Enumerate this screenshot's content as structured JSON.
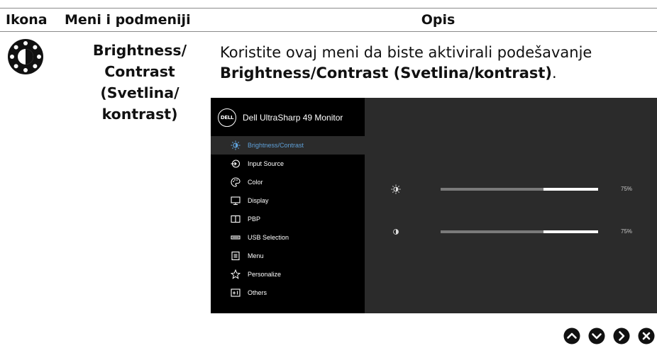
{
  "table": {
    "headers": [
      "Ikona",
      "Meni i podmeniji",
      "Opis"
    ]
  },
  "row": {
    "menu_name_lines": [
      "Brightness/",
      "Contrast",
      "(Svetlina/",
      "kontrast)"
    ],
    "desc_line1": "Koristite ovaj meni da biste aktivirali podešavanje",
    "desc_bold": "Brightness/Contrast (Svetlina/kontrast)",
    "desc_end": "."
  },
  "osd": {
    "logo_text": "DELL",
    "title": "Dell UltraSharp 49 Monitor",
    "menu_items": [
      {
        "label": "Brightness/Contrast",
        "icon": "brightness-icon",
        "active": true
      },
      {
        "label": "Input Source",
        "icon": "input-source-icon",
        "active": false
      },
      {
        "label": "Color",
        "icon": "color-icon",
        "active": false
      },
      {
        "label": "Display",
        "icon": "display-icon",
        "active": false
      },
      {
        "label": "PBP",
        "icon": "pbp-icon",
        "active": false
      },
      {
        "label": "USB Selection",
        "icon": "usb-icon",
        "active": false
      },
      {
        "label": "Menu",
        "icon": "menu-icon",
        "active": false
      },
      {
        "label": "Personalize",
        "icon": "star-icon",
        "active": false
      },
      {
        "label": "Others",
        "icon": "others-icon",
        "active": false
      }
    ],
    "sliders": [
      {
        "name": "brightness",
        "icon": "brightness-icon",
        "level": 0.75,
        "value_text": "75%"
      },
      {
        "name": "contrast",
        "icon": "contrast-icon",
        "level": 0.75,
        "value_text": "75%"
      }
    ],
    "colors": {
      "menu_bg": "#000000",
      "panel_bg": "#2b2b2b",
      "active_label": "#5fa0d8",
      "slider_track": "#7a7a7a",
      "slider_marker": "#ffffff"
    }
  },
  "nav_buttons": [
    {
      "name": "up",
      "icon": "chevron-up-icon"
    },
    {
      "name": "down",
      "icon": "chevron-down-icon"
    },
    {
      "name": "right",
      "icon": "chevron-right-icon"
    },
    {
      "name": "exit",
      "icon": "close-icon"
    }
  ]
}
